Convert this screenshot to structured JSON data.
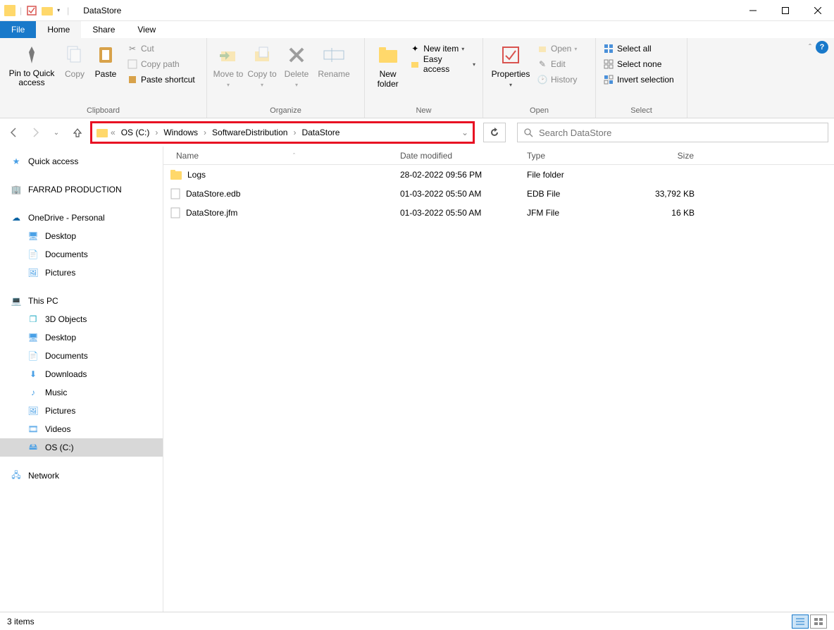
{
  "window": {
    "title": "DataStore"
  },
  "tabs": {
    "file": "File",
    "home": "Home",
    "share": "Share",
    "view": "View"
  },
  "ribbon": {
    "clipboard": {
      "label": "Clipboard",
      "pin": "Pin to Quick access",
      "copy": "Copy",
      "paste": "Paste",
      "cut": "Cut",
      "copy_path": "Copy path",
      "paste_shortcut": "Paste shortcut"
    },
    "organize": {
      "label": "Organize",
      "move_to": "Move to",
      "copy_to": "Copy to",
      "delete": "Delete",
      "rename": "Rename"
    },
    "new": {
      "label": "New",
      "new_folder": "New folder",
      "new_item": "New item",
      "easy_access": "Easy access"
    },
    "open": {
      "label": "Open",
      "properties": "Properties",
      "open": "Open",
      "edit": "Edit",
      "history": "History"
    },
    "select": {
      "label": "Select",
      "select_all": "Select all",
      "select_none": "Select none",
      "invert": "Invert selection"
    }
  },
  "breadcrumb": {
    "items": [
      "OS (C:)",
      "Windows",
      "SoftwareDistribution",
      "DataStore"
    ]
  },
  "search": {
    "placeholder": "Search DataStore"
  },
  "sidebar": {
    "quick_access": "Quick access",
    "farrad": "FARRAD PRODUCTION",
    "onedrive": "OneDrive - Personal",
    "od_desktop": "Desktop",
    "od_documents": "Documents",
    "od_pictures": "Pictures",
    "this_pc": "This PC",
    "pc_3d": "3D Objects",
    "pc_desktop": "Desktop",
    "pc_documents": "Documents",
    "pc_downloads": "Downloads",
    "pc_music": "Music",
    "pc_pictures": "Pictures",
    "pc_videos": "Videos",
    "pc_osc": "OS (C:)",
    "network": "Network"
  },
  "columns": {
    "name": "Name",
    "date": "Date modified",
    "type": "Type",
    "size": "Size"
  },
  "files": [
    {
      "name": "Logs",
      "date": "28-02-2022 09:56 PM",
      "type": "File folder",
      "size": "",
      "icon": "folder"
    },
    {
      "name": "DataStore.edb",
      "date": "01-03-2022 05:50 AM",
      "type": "EDB File",
      "size": "33,792 KB",
      "icon": "file"
    },
    {
      "name": "DataStore.jfm",
      "date": "01-03-2022 05:50 AM",
      "type": "JFM File",
      "size": "16 KB",
      "icon": "file"
    }
  ],
  "status": {
    "items": "3 items"
  }
}
